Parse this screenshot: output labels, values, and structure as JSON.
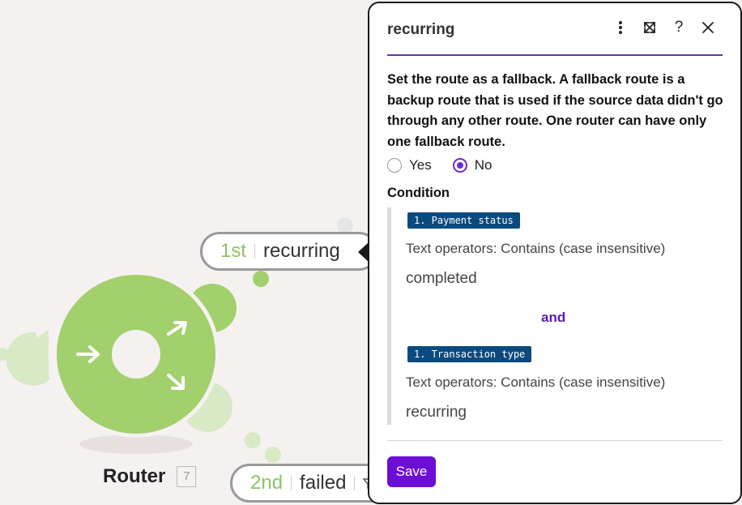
{
  "canvas": {
    "module": {
      "name": "Router",
      "id": "7"
    },
    "routes": [
      {
        "order": "1st",
        "label": "recurring"
      },
      {
        "order": "2nd",
        "label": "failed"
      }
    ],
    "colors": {
      "module_green": "#a2d06d",
      "accent_purple": "#6d0ed6",
      "pill_blue": "#0b4a7e"
    }
  },
  "panel": {
    "title": "recurring",
    "header_icons": [
      "more-vertical-icon",
      "expand-icon",
      "help-icon",
      "close-icon"
    ],
    "fallback": {
      "description": "Set the route as a fallback. A fallback route is a backup route that is used if the source data didn't go through any other route. One router can have only one fallback route.",
      "options": [
        {
          "label": "Yes",
          "checked": false
        },
        {
          "label": "No",
          "checked": true
        }
      ]
    },
    "condition": {
      "label": "Condition",
      "joiner": "and",
      "rules": [
        {
          "field": "1. Payment status",
          "operator": "Text operators: Contains (case insensitive)",
          "value": "completed"
        },
        {
          "field": "1. Transaction type",
          "operator": "Text operators: Contains (case insensitive)",
          "value": "recurring"
        }
      ]
    },
    "save_label": "Save"
  }
}
